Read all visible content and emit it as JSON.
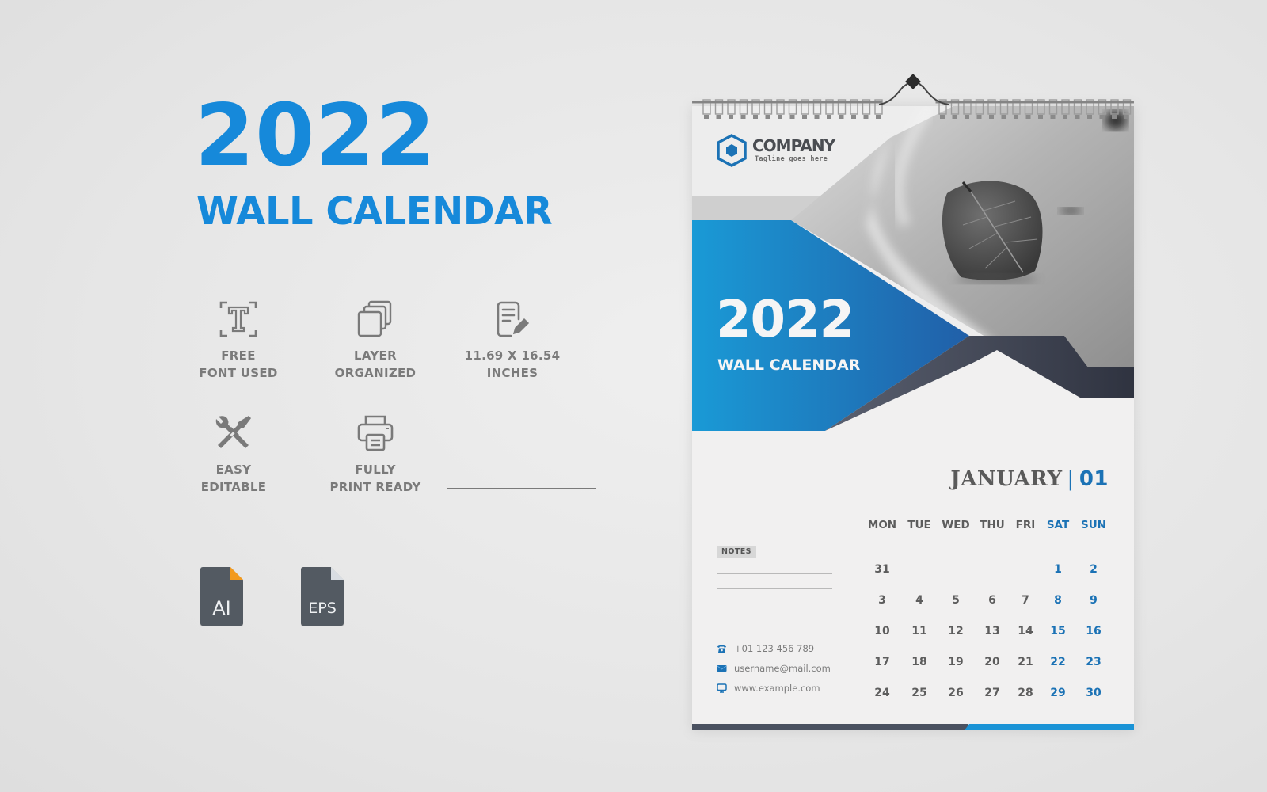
{
  "promo": {
    "year": "2022",
    "title": "WALL CALENDAR",
    "accent_color": "#1689da",
    "features": [
      {
        "icon": "text-font-icon",
        "line1": "FREE",
        "line2": "FONT USED"
      },
      {
        "icon": "layers-icon",
        "line1": "LAYER",
        "line2": "ORGANIZED"
      },
      {
        "icon": "document-edit-icon",
        "line1": "11.69 X 16.54",
        "line2": "INCHES"
      },
      {
        "icon": "tools-icon",
        "line1": "EASY",
        "line2": "EDITABLE"
      },
      {
        "icon": "printer-icon",
        "line1": "FULLY",
        "line2": "PRINT READY"
      }
    ],
    "file_formats": [
      {
        "icon": "ai-file-icon",
        "label": "AI",
        "fold_color": "#f29a1f"
      },
      {
        "icon": "eps-file-icon",
        "label": "EPS",
        "fold_color": "#d9dde2"
      }
    ]
  },
  "calendar": {
    "company_name": "COMPANY",
    "tagline": "Tagline goes here",
    "cover_year": "2022",
    "cover_title": "WALL CALENDAR",
    "month_name": "JANUARY",
    "month_separator": "|",
    "month_number": "01",
    "weekdays": [
      "MON",
      "TUE",
      "WED",
      "THU",
      "FRI",
      "SAT",
      "SUN"
    ],
    "weekend_color": "#1b72b5",
    "weeks": [
      [
        "31",
        "",
        "",
        "",
        "",
        "1",
        "2"
      ],
      [
        "3",
        "4",
        "5",
        "6",
        "7",
        "8",
        "9"
      ],
      [
        "10",
        "11",
        "12",
        "13",
        "14",
        "15",
        "16"
      ],
      [
        "17",
        "18",
        "19",
        "20",
        "21",
        "22",
        "23"
      ],
      [
        "24",
        "25",
        "26",
        "27",
        "28",
        "29",
        "30"
      ]
    ],
    "notes_label": "NOTES",
    "contacts": {
      "phone": "+01 123 456 789",
      "email": "username@mail.com",
      "website": "www.example.com"
    },
    "brand_blue": "#1a93d6",
    "brand_dark": "#3c4250"
  }
}
